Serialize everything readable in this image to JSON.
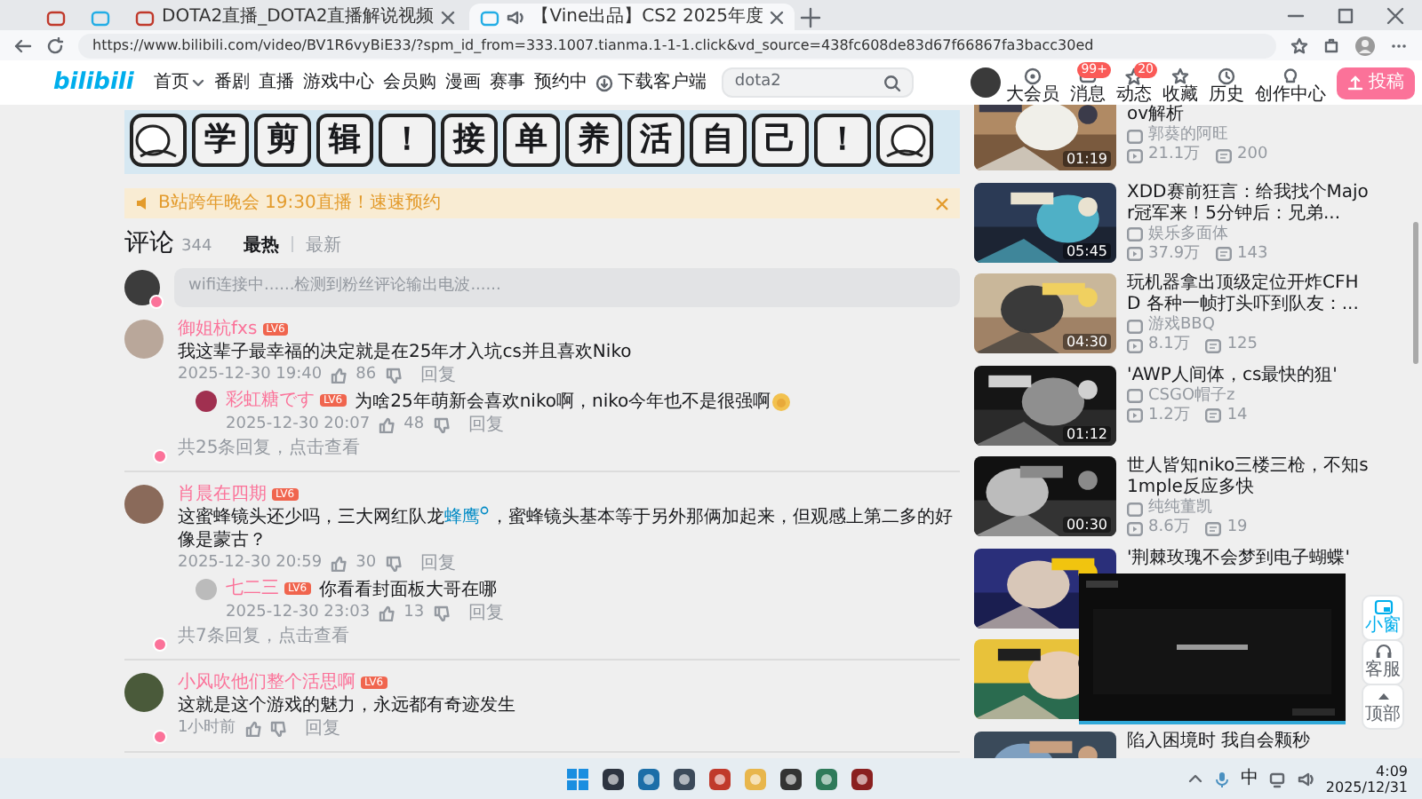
{
  "browser": {
    "tabs": [
      {
        "kind": "pinned",
        "selected": false
      },
      {
        "kind": "pinned",
        "selected": false
      },
      {
        "kind": "page",
        "title": "DOTA2直播_DOTA2直播解说视频",
        "selected": false
      },
      {
        "kind": "page",
        "title": "【Vine出品】CS2 2025年度",
        "audio": true,
        "selected": true
      }
    ],
    "url": "https://www.bilibili.com/video/BV1R6vyBiE33/?spm_id_from=333.1007.tianma.1-1-1.click&vd_source=438fc608de83d67f66867fa3bacc30ed"
  },
  "header": {
    "logo": "bilibili",
    "nav": [
      {
        "label": "首页",
        "kind": "dropdown"
      },
      {
        "label": "番剧",
        "kind": "plain"
      },
      {
        "label": "直播",
        "kind": "plain"
      },
      {
        "label": "游戏中心",
        "kind": "plain"
      },
      {
        "label": "会员购",
        "kind": "plain"
      },
      {
        "label": "漫画",
        "kind": "plain"
      },
      {
        "label": "赛事",
        "kind": "plain"
      },
      {
        "label": "预约中",
        "kind": "plain"
      },
      {
        "label": "下载客户端",
        "kind": "download"
      }
    ],
    "search": {
      "value": "dota2"
    },
    "actions": [
      {
        "label": "大会员"
      },
      {
        "label": "消息",
        "badge": "99+"
      },
      {
        "label": "动态",
        "badge": "20"
      },
      {
        "label": "收藏"
      },
      {
        "label": "历史"
      },
      {
        "label": "创作中心"
      }
    ],
    "upload_button": "投稿"
  },
  "banner": {
    "stickers": [
      {
        "kind": "picture"
      },
      {
        "kind": "char",
        "text": "学"
      },
      {
        "kind": "char",
        "text": "剪"
      },
      {
        "kind": "char",
        "text": "辑"
      },
      {
        "kind": "char",
        "text": "！"
      },
      {
        "kind": "char",
        "text": "接"
      },
      {
        "kind": "char",
        "text": "单"
      },
      {
        "kind": "char",
        "text": "养"
      },
      {
        "kind": "char",
        "text": "活"
      },
      {
        "kind": "char",
        "text": "自"
      },
      {
        "kind": "char",
        "text": "己"
      },
      {
        "kind": "char",
        "text": "！"
      },
      {
        "kind": "picture"
      }
    ]
  },
  "notice": {
    "text": "B站跨年晚会 19:30直播！速速预约"
  },
  "comments": {
    "title": "评论",
    "count": "344",
    "sort": [
      {
        "label": "最热",
        "selected": true
      },
      {
        "label": "最新",
        "selected": false
      }
    ],
    "input": {
      "placeholder": "wifi连接中......检测到粉丝评论输出电波......"
    },
    "items": [
      {
        "user": "御姐杭fxs",
        "level": "LV6",
        "parts": [
          {
            "kind": "text",
            "text": "我这辈子最幸福的决定就是在25年才入坑cs并且喜欢Niko"
          }
        ],
        "time": "2025-12-30 19:40",
        "likes": "86",
        "reply": "回复",
        "replies": [
          {
            "user": "彩虹糖です",
            "level": "LV6",
            "parts": [
              {
                "kind": "text",
                "text": "为啥25年萌新会喜欢niko啊，niko今年也不是很强啊"
              },
              {
                "kind": "sticker"
              }
            ],
            "time": "2025-12-30 20:07",
            "likes": "48",
            "reply": "回复"
          }
        ],
        "more": "共25条回复，点击查看"
      },
      {
        "user": "肖晨在四期",
        "level": "LV6",
        "parts": [
          {
            "kind": "text",
            "text": "这蜜蜂镜头还少吗，三大网红队龙"
          },
          {
            "kind": "link",
            "text": "蜂鹰"
          },
          {
            "kind": "text",
            "text": "，蜜蜂镜头基本等于另外那俩加起来，但观感上第二多的好像是蒙古？"
          }
        ],
        "time": "2025-12-30 20:59",
        "likes": "30",
        "reply": "回复",
        "replies": [
          {
            "user": "七二三",
            "level": "LV6",
            "parts": [
              {
                "kind": "text",
                "text": "你看看封面板大哥在哪"
              }
            ],
            "time": "2025-12-30 23:03",
            "likes": "13",
            "reply": "回复"
          }
        ],
        "more": "共7条回复，点击查看"
      },
      {
        "user": "小风吹他们整个活思啊",
        "level": "LV6",
        "parts": [
          {
            "kind": "text",
            "text": "这就是这个游戏的魅力，永远都有奇迹发生"
          }
        ],
        "time": "1小时前",
        "reply": "回复"
      }
    ]
  },
  "recommendations": [
    {
      "title": "ov解析",
      "duration": "01:19",
      "uploader": "郭葵的阿旺",
      "plays": "21.1万",
      "comments": "200"
    },
    {
      "title": "XDD赛前狂言：给我找个Major冠军来！5分钟后：兄弟...",
      "duration": "05:45",
      "uploader": "娱乐多面体",
      "plays": "37.9万",
      "comments": "143"
    },
    {
      "title": "玩机器拿出顶级定位开炸CFHD 各种一帧打头吓到队友：...",
      "duration": "04:30",
      "uploader": "游戏BBQ",
      "plays": "8.1万",
      "comments": "125"
    },
    {
      "title": "'AWP人间体，cs最快的狙'",
      "duration": "01:12",
      "uploader": "CSGO帽子z",
      "plays": "1.2万",
      "comments": "14"
    },
    {
      "title": "世人皆知niko三楼三枪，不知s1mple反应多快",
      "duration": "00:30",
      "uploader": "纯纯董凯",
      "plays": "8.6万",
      "comments": "19"
    },
    {
      "title": "'荆棘玫瑰不会梦到电子蝴蝶'"
    },
    {
      "kind": "picture"
    },
    {
      "title": "陷入困境时 我自会颗秒"
    }
  ],
  "mini_player": {
    "kind": "picture"
  },
  "side_buttons": [
    {
      "label": "小窗"
    },
    {
      "label": "客服"
    },
    {
      "label": "顶部"
    }
  ],
  "taskbar": {
    "ime": "中",
    "time": "4:09",
    "date": "2025/12/31"
  }
}
